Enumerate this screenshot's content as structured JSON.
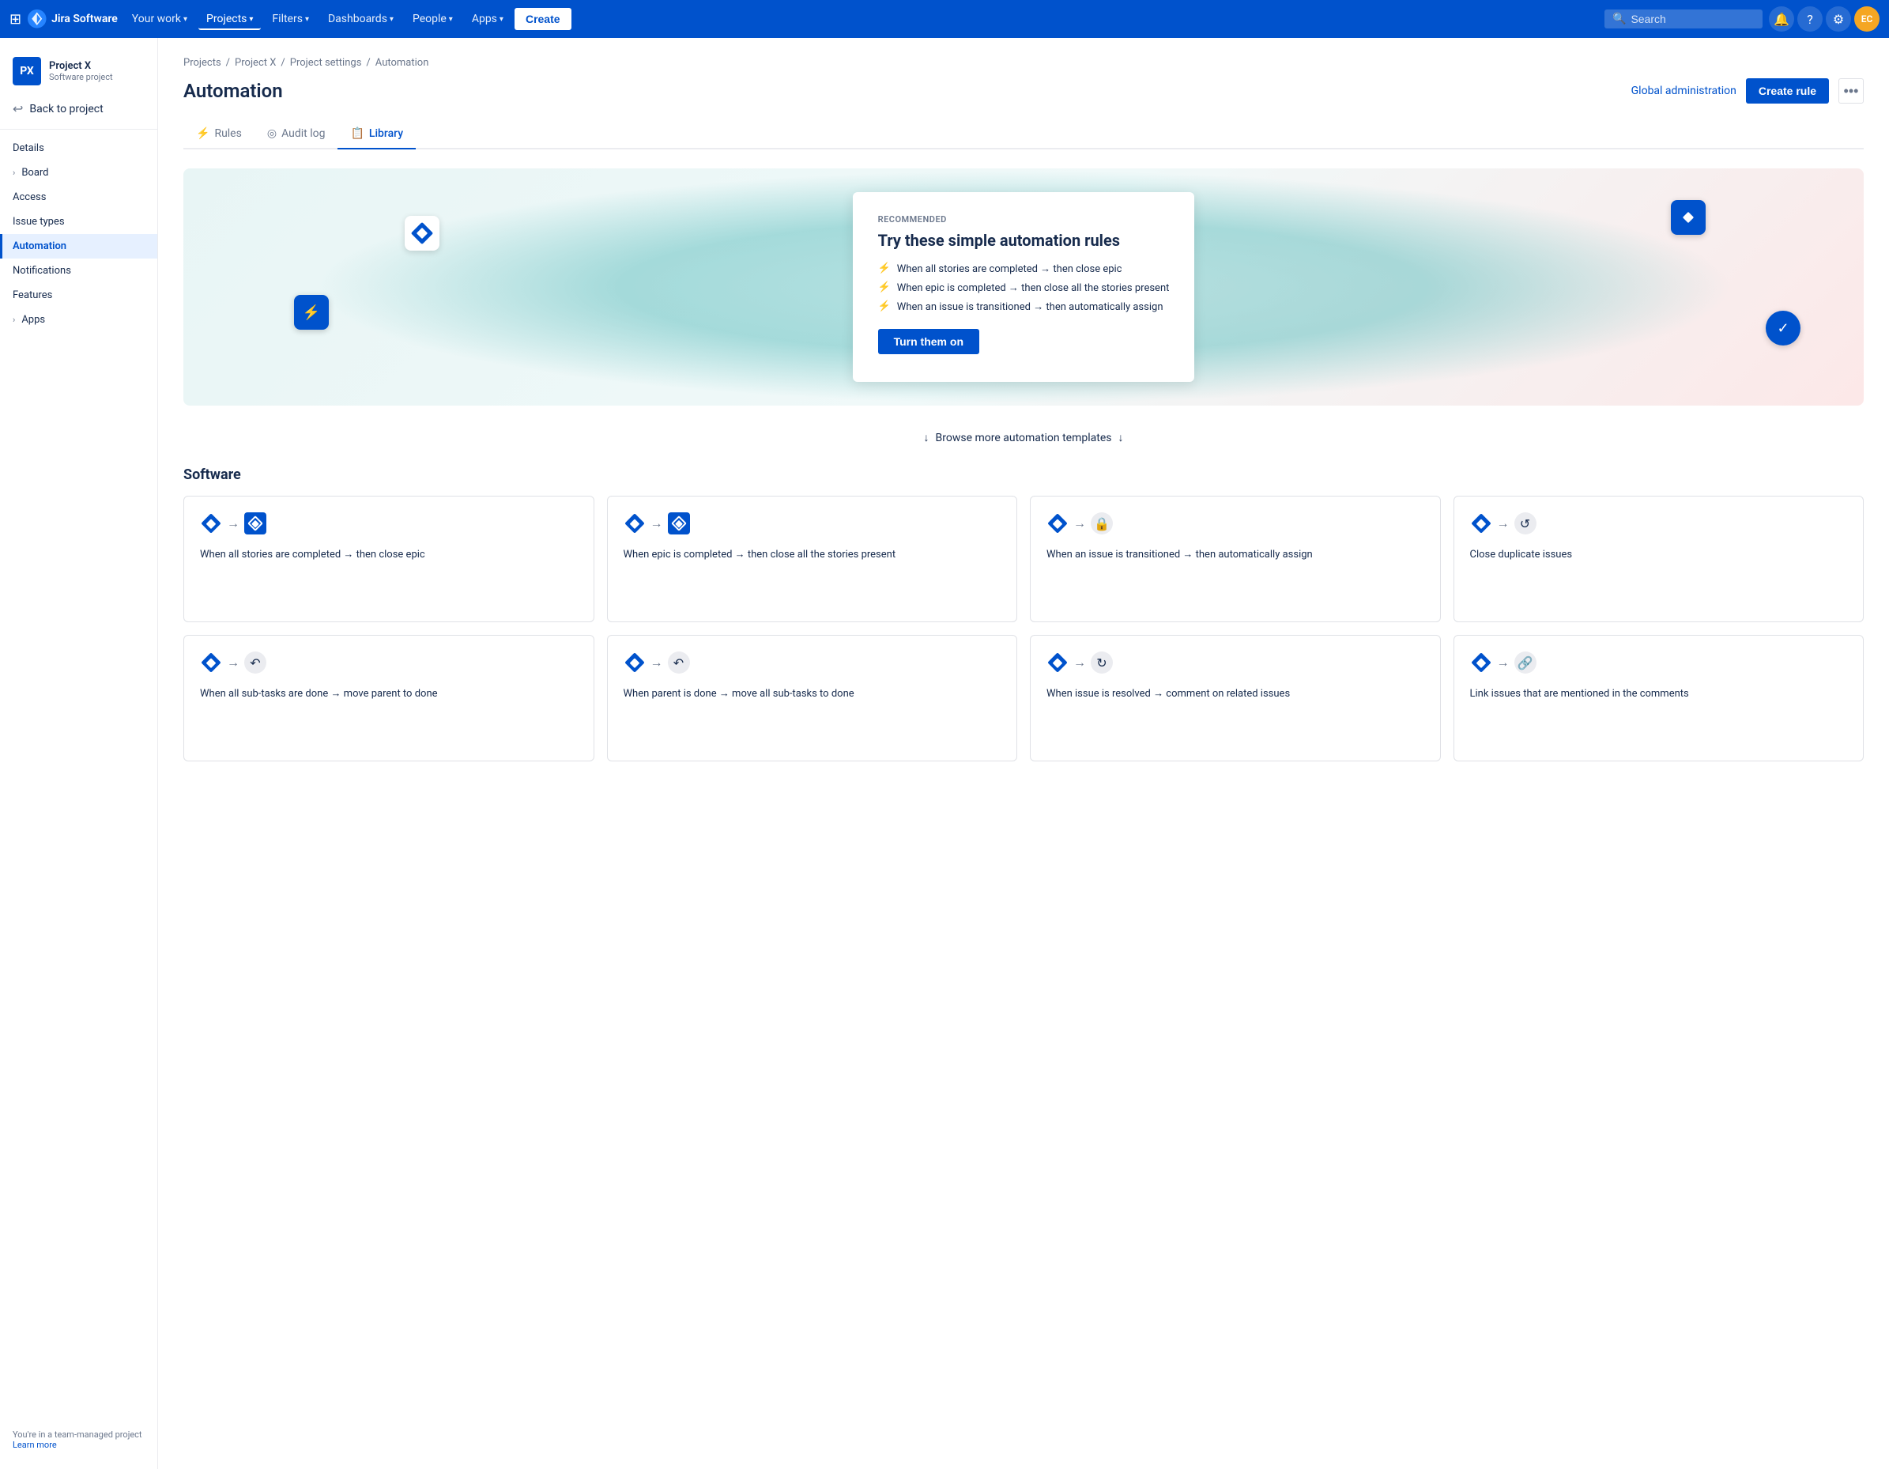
{
  "topnav": {
    "logo_text": "Jira Software",
    "nav_items": [
      {
        "label": "Your work",
        "has_chevron": true
      },
      {
        "label": "Projects",
        "has_chevron": true,
        "active": true
      },
      {
        "label": "Filters",
        "has_chevron": true
      },
      {
        "label": "Dashboards",
        "has_chevron": true
      },
      {
        "label": "People",
        "has_chevron": true
      },
      {
        "label": "Apps",
        "has_chevron": true
      }
    ],
    "create_label": "Create",
    "search_placeholder": "Search",
    "avatar_text": "EC"
  },
  "sidebar": {
    "project_name": "Project X",
    "project_type": "Software project",
    "project_initials": "PX",
    "back_label": "Back to project",
    "items": [
      {
        "label": "Details",
        "active": false
      },
      {
        "label": "Board",
        "active": false,
        "has_expand": true
      },
      {
        "label": "Access",
        "active": false
      },
      {
        "label": "Issue types",
        "active": false
      },
      {
        "label": "Automation",
        "active": true
      },
      {
        "label": "Notifications",
        "active": false
      },
      {
        "label": "Features",
        "active": false
      },
      {
        "label": "Apps",
        "active": false,
        "has_expand": true
      }
    ],
    "bottom_text": "You're in a team-managed project",
    "learn_more_label": "Learn more"
  },
  "breadcrumb": {
    "items": [
      "Projects",
      "Project X",
      "Project settings",
      "Automation"
    ]
  },
  "page": {
    "title": "Automation",
    "global_admin_label": "Global administration",
    "create_rule_label": "Create rule"
  },
  "tabs": [
    {
      "label": "Rules",
      "icon": "⚡",
      "active": false
    },
    {
      "label": "Audit log",
      "icon": "◎",
      "active": false
    },
    {
      "label": "Library",
      "icon": "📋",
      "active": true
    }
  ],
  "hero": {
    "recommended_label": "RECOMMENDED",
    "title": "Try these simple automation rules",
    "rules": [
      "When all stories are completed → then close epic",
      "When epic is completed → then close all the stories present",
      "When an issue is transitioned → then automatically assign"
    ],
    "turn_on_label": "Turn them on"
  },
  "browse_label": "Browse more automation templates",
  "software_section": {
    "title": "Software",
    "cards": [
      {
        "text": "When all stories are completed → then close epic",
        "start_icon": "diamond",
        "end_icon": "diamond",
        "end_type": "blue"
      },
      {
        "text": "When epic is completed → then close all the stories present",
        "start_icon": "diamond",
        "end_icon": "diamond",
        "end_type": "blue"
      },
      {
        "text": "When an issue is transitioned → then automatically assign",
        "start_icon": "diamond",
        "end_icon": "lock",
        "end_type": "circle"
      },
      {
        "text": "Close duplicate issues",
        "start_icon": "diamond",
        "end_icon": "loop",
        "end_type": "circle"
      },
      {
        "text": "When all sub-tasks are done → move parent to done",
        "start_icon": "diamond",
        "end_icon": "subtask",
        "end_type": "circle"
      },
      {
        "text": "When parent is done → move all sub-tasks to done",
        "start_icon": "diamond",
        "end_icon": "subtask",
        "end_type": "circle"
      },
      {
        "text": "When issue is resolved → comment on related issues",
        "start_icon": "diamond",
        "end_icon": "refresh",
        "end_type": "circle"
      },
      {
        "text": "Link issues that are mentioned in the comments",
        "start_icon": "diamond",
        "end_icon": "link",
        "end_type": "circle"
      }
    ]
  }
}
